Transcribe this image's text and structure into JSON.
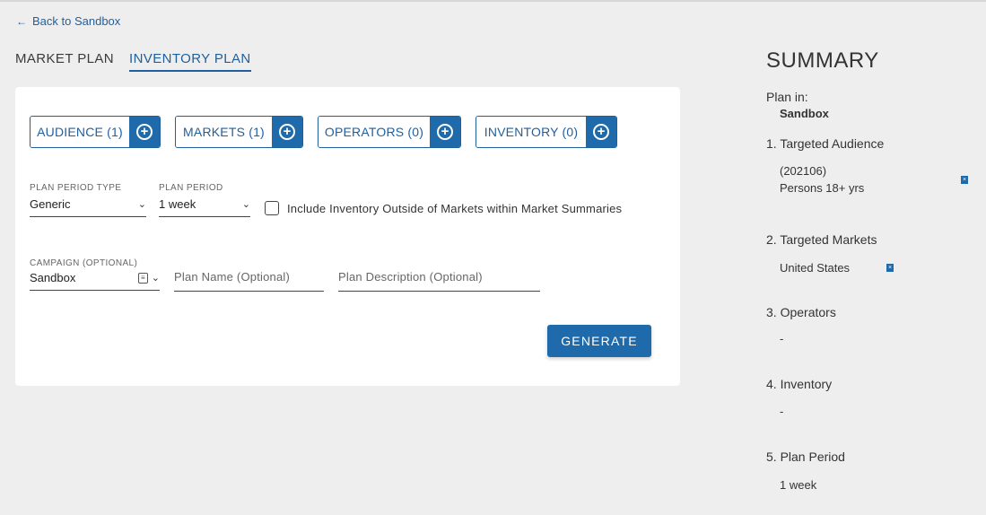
{
  "nav": {
    "back_label": "Back to Sandbox"
  },
  "tabs": [
    {
      "label": "MARKET PLAN",
      "active": false
    },
    {
      "label": "INVENTORY PLAN",
      "active": true
    }
  ],
  "chips": [
    {
      "label": "AUDIENCE (1)"
    },
    {
      "label": "MARKETS (1)"
    },
    {
      "label": "OPERATORS (0)"
    },
    {
      "label": "INVENTORY (0)"
    }
  ],
  "form": {
    "plan_period_type": {
      "label": "PLAN PERIOD TYPE",
      "value": "Generic"
    },
    "plan_period": {
      "label": "PLAN PERIOD",
      "value": "1 week"
    },
    "include_outside_label": "Include Inventory Outside of Markets within Market Summaries",
    "campaign": {
      "label": "CAMPAIGN (OPTIONAL)",
      "value": "Sandbox"
    },
    "plan_name_placeholder": "Plan Name (Optional)",
    "plan_description_placeholder": "Plan Description (Optional)",
    "generate_label": "GENERATE"
  },
  "summary": {
    "title": "SUMMARY",
    "plan_in_label": "Plan in:",
    "plan_in_value": "Sandbox",
    "sections": {
      "audience": {
        "heading": "1. Targeted Audience",
        "code": "(202106)",
        "name": "Persons 18+ yrs"
      },
      "markets": {
        "heading": "2. Targeted Markets",
        "value": "United States"
      },
      "operators": {
        "heading": "3. Operators",
        "value": "-"
      },
      "inventory": {
        "heading": "4. Inventory",
        "value": "-"
      },
      "period": {
        "heading": "5. Plan Period",
        "value": "1 week"
      }
    }
  },
  "colors": {
    "accent": "#1f6aab",
    "link": "#1f5f9e",
    "background": "#eeeeee"
  }
}
